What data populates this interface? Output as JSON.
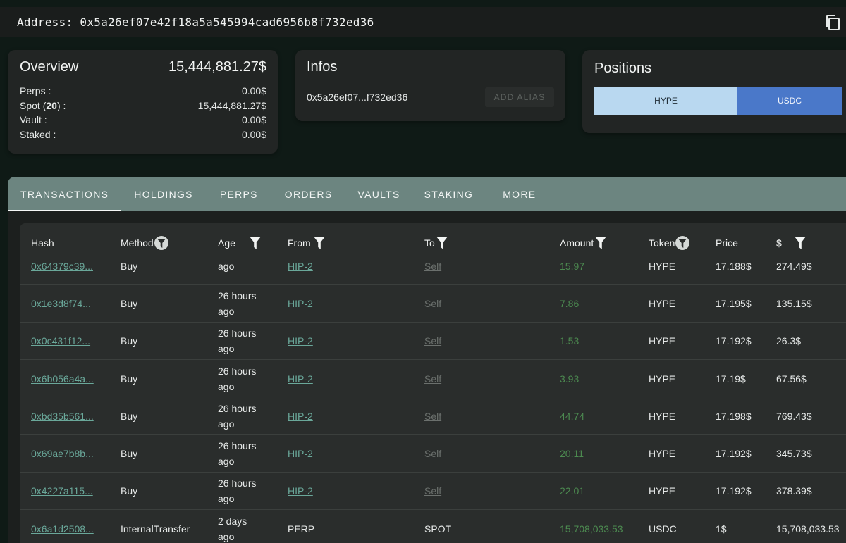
{
  "address_label": "Address: 0x5a26ef07e42f18a5a545994cad6956b8f732ed36",
  "overview": {
    "title": "Overview",
    "total": "15,444,881.27$",
    "rows": [
      {
        "label": "Perps :",
        "value": "0.00$"
      },
      {
        "label_prefix": "Spot (",
        "label_count": "20",
        "label_suffix": ") :",
        "value": "15,444,881.27$"
      },
      {
        "label": "Vault :",
        "value": "0.00$"
      },
      {
        "label": "Staked :",
        "value": "0.00$"
      }
    ]
  },
  "infos": {
    "title": "Infos",
    "short_address": "0x5a26ef07...f732ed36",
    "alias_button": "ADD ALIAS"
  },
  "positions": {
    "title": "Positions",
    "segments": [
      {
        "label": "HYPE",
        "color": "#b9d8f0"
      },
      {
        "label": "USDC",
        "color": "#4a78c9"
      }
    ]
  },
  "tabs": [
    "TRANSACTIONS",
    "HOLDINGS",
    "PERPS",
    "ORDERS",
    "VAULTS",
    "STAKING",
    "MORE"
  ],
  "active_tab": "TRANSACTIONS",
  "table": {
    "columns": [
      "Hash",
      "Method",
      "Age",
      "From",
      "To",
      "Amount",
      "Token",
      "Price",
      "$"
    ],
    "rows": [
      {
        "hash": "0x64379c39...",
        "method": "Buy",
        "age1": "",
        "age2": "ago",
        "from": "HIP-2",
        "to": "Self",
        "amount": "15.97",
        "token": "HYPE",
        "price": "17.188$",
        "usd": "274.49$"
      },
      {
        "hash": "0x1e3d8f74...",
        "method": "Buy",
        "age1": "26 hours",
        "age2": "ago",
        "from": "HIP-2",
        "to": "Self",
        "amount": "7.86",
        "token": "HYPE",
        "price": "17.195$",
        "usd": "135.15$"
      },
      {
        "hash": "0x0c431f12...",
        "method": "Buy",
        "age1": "26 hours",
        "age2": "ago",
        "from": "HIP-2",
        "to": "Self",
        "amount": "1.53",
        "token": "HYPE",
        "price": "17.192$",
        "usd": "26.3$"
      },
      {
        "hash": "0x6b056a4a...",
        "method": "Buy",
        "age1": "26 hours",
        "age2": "ago",
        "from": "HIP-2",
        "to": "Self",
        "amount": "3.93",
        "token": "HYPE",
        "price": "17.19$",
        "usd": "67.56$"
      },
      {
        "hash": "0xbd35b561...",
        "method": "Buy",
        "age1": "26 hours",
        "age2": "ago",
        "from": "HIP-2",
        "to": "Self",
        "amount": "44.74",
        "token": "HYPE",
        "price": "17.198$",
        "usd": "769.43$"
      },
      {
        "hash": "0x69ae7b8b...",
        "method": "Buy",
        "age1": "26 hours",
        "age2": "ago",
        "from": "HIP-2",
        "to": "Self",
        "amount": "20.11",
        "token": "HYPE",
        "price": "17.192$",
        "usd": "345.73$"
      },
      {
        "hash": "0x4227a115...",
        "method": "Buy",
        "age1": "26 hours",
        "age2": "ago",
        "from": "HIP-2",
        "to": "Self",
        "amount": "22.01",
        "token": "HYPE",
        "price": "17.192$",
        "usd": "378.39$"
      },
      {
        "hash": "0x6a1d2508...",
        "method": "InternalTransfer",
        "age1": "2 days",
        "age2": "ago",
        "from": "PERP",
        "to": "SPOT",
        "amount": "15,708,033.53",
        "token": "USDC",
        "price": "1$",
        "usd": "15,708,033.53"
      }
    ]
  }
}
